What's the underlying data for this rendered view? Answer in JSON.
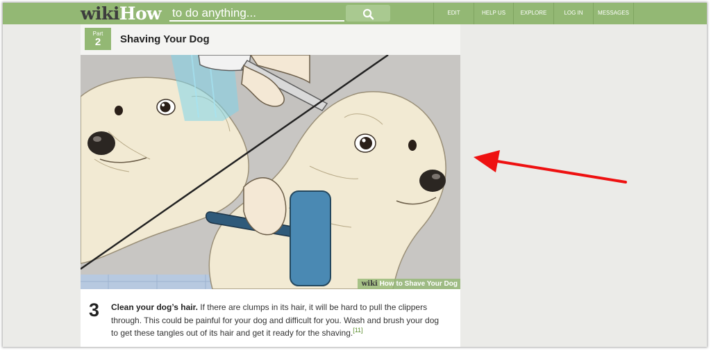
{
  "header": {
    "logo_wiki": "wiki",
    "logo_how": "How",
    "search_placeholder": "to do anything...",
    "search_button_icon": "search-icon",
    "nav": [
      "EDIT",
      "HELP US",
      "EXPLORE",
      "LOG IN",
      "MESSAGES"
    ]
  },
  "article": {
    "part_label": "Part",
    "part_number": "2",
    "part_title": "Shaving Your Dog",
    "image_watermark": {
      "wiki": "wiki",
      "rest": "How to Shave Your Dog"
    },
    "step": {
      "number": "3",
      "bold": "Clean your dog’s hair.",
      "text": " If there are clumps in its hair, it will be hard to pull the clippers through. This could be painful for your dog and difficult for you. Wash and brush your dog to get these tangles out of its hair and get it ready for the shaving.",
      "citation": "[11]"
    }
  },
  "colors": {
    "header_green": "#93b874",
    "annotation_arrow": "#ee1111",
    "page_background": "#ebebe8"
  }
}
